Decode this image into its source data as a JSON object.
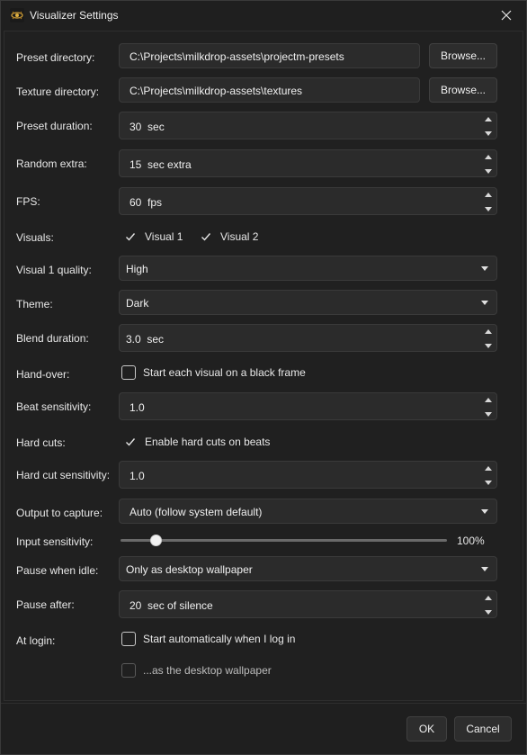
{
  "window": {
    "title": "Visualizer Settings",
    "app_icon": "visualizer-app-icon",
    "close_icon": "close-icon"
  },
  "rows": {
    "preset_directory": {
      "label": "Preset directory:",
      "value": "C:\\Projects\\milkdrop-assets\\projectm-presets",
      "button": "Browse..."
    },
    "texture_directory": {
      "label": "Texture directory:",
      "value": "C:\\Projects\\milkdrop-assets\\textures",
      "button": "Browse..."
    },
    "preset_duration": {
      "label": "Preset duration:",
      "value": "30",
      "suffix": "sec"
    },
    "random_extra": {
      "label": "Random extra:",
      "value": "15",
      "suffix": "sec extra"
    },
    "fps": {
      "label": "FPS:",
      "value": "60",
      "suffix": "fps"
    },
    "visuals": {
      "label": "Visuals:",
      "options": [
        {
          "label": "Visual 1",
          "checked": true
        },
        {
          "label": "Visual 2",
          "checked": true
        }
      ]
    },
    "visual1_quality": {
      "label": "Visual 1 quality:",
      "selected": "High"
    },
    "theme": {
      "label": "Theme:",
      "selected": "Dark"
    },
    "blend_duration": {
      "label": "Blend duration:",
      "value": "3.0",
      "suffix": "sec"
    },
    "hand_over": {
      "label": "Hand-over:",
      "option": "Start each visual on a black frame",
      "checked": false
    },
    "beat_sensitivity": {
      "label": "Beat sensitivity:",
      "value": "1.0"
    },
    "hard_cuts": {
      "label": "Hard cuts:",
      "option": "Enable hard cuts on beats",
      "checked": true
    },
    "hard_cut_sensitivity": {
      "label": "Hard cut sensitivity:",
      "value": "1.0"
    },
    "output_to_capture": {
      "label": "Output to capture:",
      "selected": "Auto (follow system default)"
    },
    "input_sensitivity": {
      "label": "Input sensitivity:",
      "value_text": "100%",
      "level": 0.11
    },
    "pause_when_idle": {
      "label": "Pause when idle:",
      "selected": "Only as desktop wallpaper"
    },
    "pause_after": {
      "label": "Pause after:",
      "value": "20",
      "suffix": "sec of silence"
    },
    "at_login": {
      "label": "At login:",
      "option": "Start automatically when I log in",
      "checked": false,
      "sub_option": "...as the desktop wallpaper",
      "sub_checked": false
    }
  },
  "footer": {
    "ok": "OK",
    "cancel": "Cancel"
  }
}
